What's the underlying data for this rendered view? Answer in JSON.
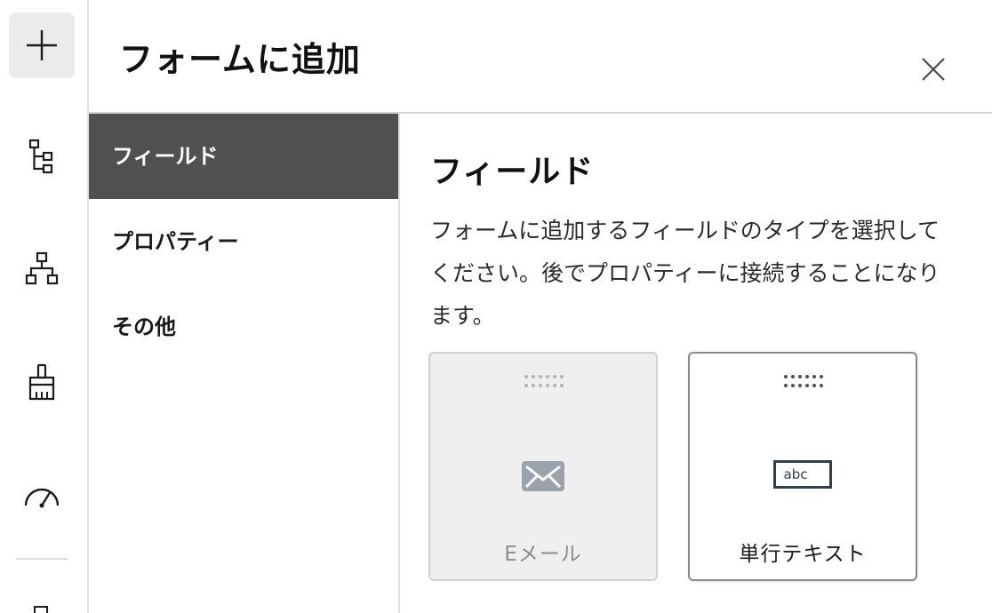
{
  "panel": {
    "title": "フォームに追加",
    "close_icon": "close-icon"
  },
  "rail": {
    "items": [
      {
        "icon": "plus-icon",
        "active": true
      },
      {
        "icon": "tree-structure-icon",
        "active": false
      },
      {
        "icon": "hierarchy-icon",
        "active": false
      },
      {
        "icon": "paint-brush-icon",
        "active": false
      },
      {
        "icon": "gauge-icon",
        "active": false
      }
    ]
  },
  "menu": {
    "items": [
      {
        "label": "フィールド",
        "active": true
      },
      {
        "label": "プロパティー",
        "active": false
      },
      {
        "label": "その他",
        "active": false
      }
    ]
  },
  "content": {
    "title": "フィールド",
    "description": "フォームに追加するフィールドのタイプを選択してください。後でプロパティーに接続することになります。",
    "tiles": [
      {
        "label": "Eメール",
        "icon": "email-icon",
        "enabled": false
      },
      {
        "label": "単行テキスト",
        "icon": "text-field-icon",
        "icon_text": "abc",
        "enabled": true
      }
    ]
  },
  "colors": {
    "active_menu_bg": "#505050",
    "active_rail_bg": "#ebebeb",
    "disabled_tile_bg": "#efefef"
  }
}
